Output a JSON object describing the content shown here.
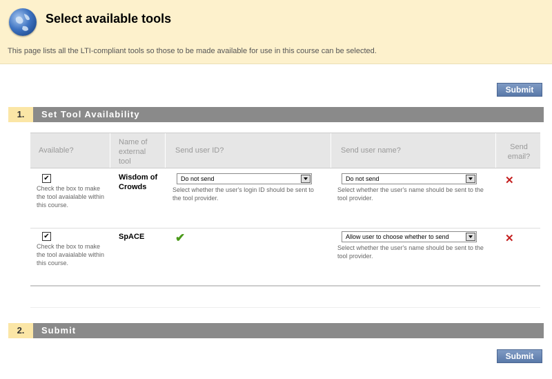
{
  "header": {
    "title": "Select available tools",
    "description": "This page lists all the LTI-compliant tools so those to be made available for use in this course can be selected."
  },
  "buttons": {
    "submit_top": "Submit",
    "submit_bottom": "Submit"
  },
  "sections": [
    {
      "number": "1.",
      "title": "Set Tool Availability"
    },
    {
      "number": "2.",
      "title": "Submit"
    }
  ],
  "table": {
    "headers": {
      "available": "Available?",
      "name": "Name of external tool",
      "send_id": "Send user ID?",
      "send_name": "Send user name?",
      "send_email": "Send email?"
    },
    "rows": [
      {
        "checked": "✔",
        "available_help": "Check the box to make the tool avaialable within this course.",
        "tool_name": "Wisdom of Crowds",
        "send_id_value": "Do not send",
        "send_id_help": "Select whether the user's login ID should be sent to the tool provider.",
        "send_name_value": "Do not send",
        "send_name_help": "Select whether the user's name should be sent to the tool provider.",
        "email": "✕"
      },
      {
        "checked": "✔",
        "available_help": "Check the box to make the tool avaialable within this course.",
        "tool_name": "SpACE",
        "send_id_status": "✔",
        "send_name_value": "Allow user to choose whether to send",
        "send_name_help": "Select whether the user's name should be sent to the tool provider.",
        "email": "✕"
      }
    ]
  },
  "colors": {
    "header_bg": "#fdf1cc",
    "section_bar": "#8a8a8a",
    "section_num_bg": "#fbe6a6",
    "button": "#6a87b6"
  }
}
